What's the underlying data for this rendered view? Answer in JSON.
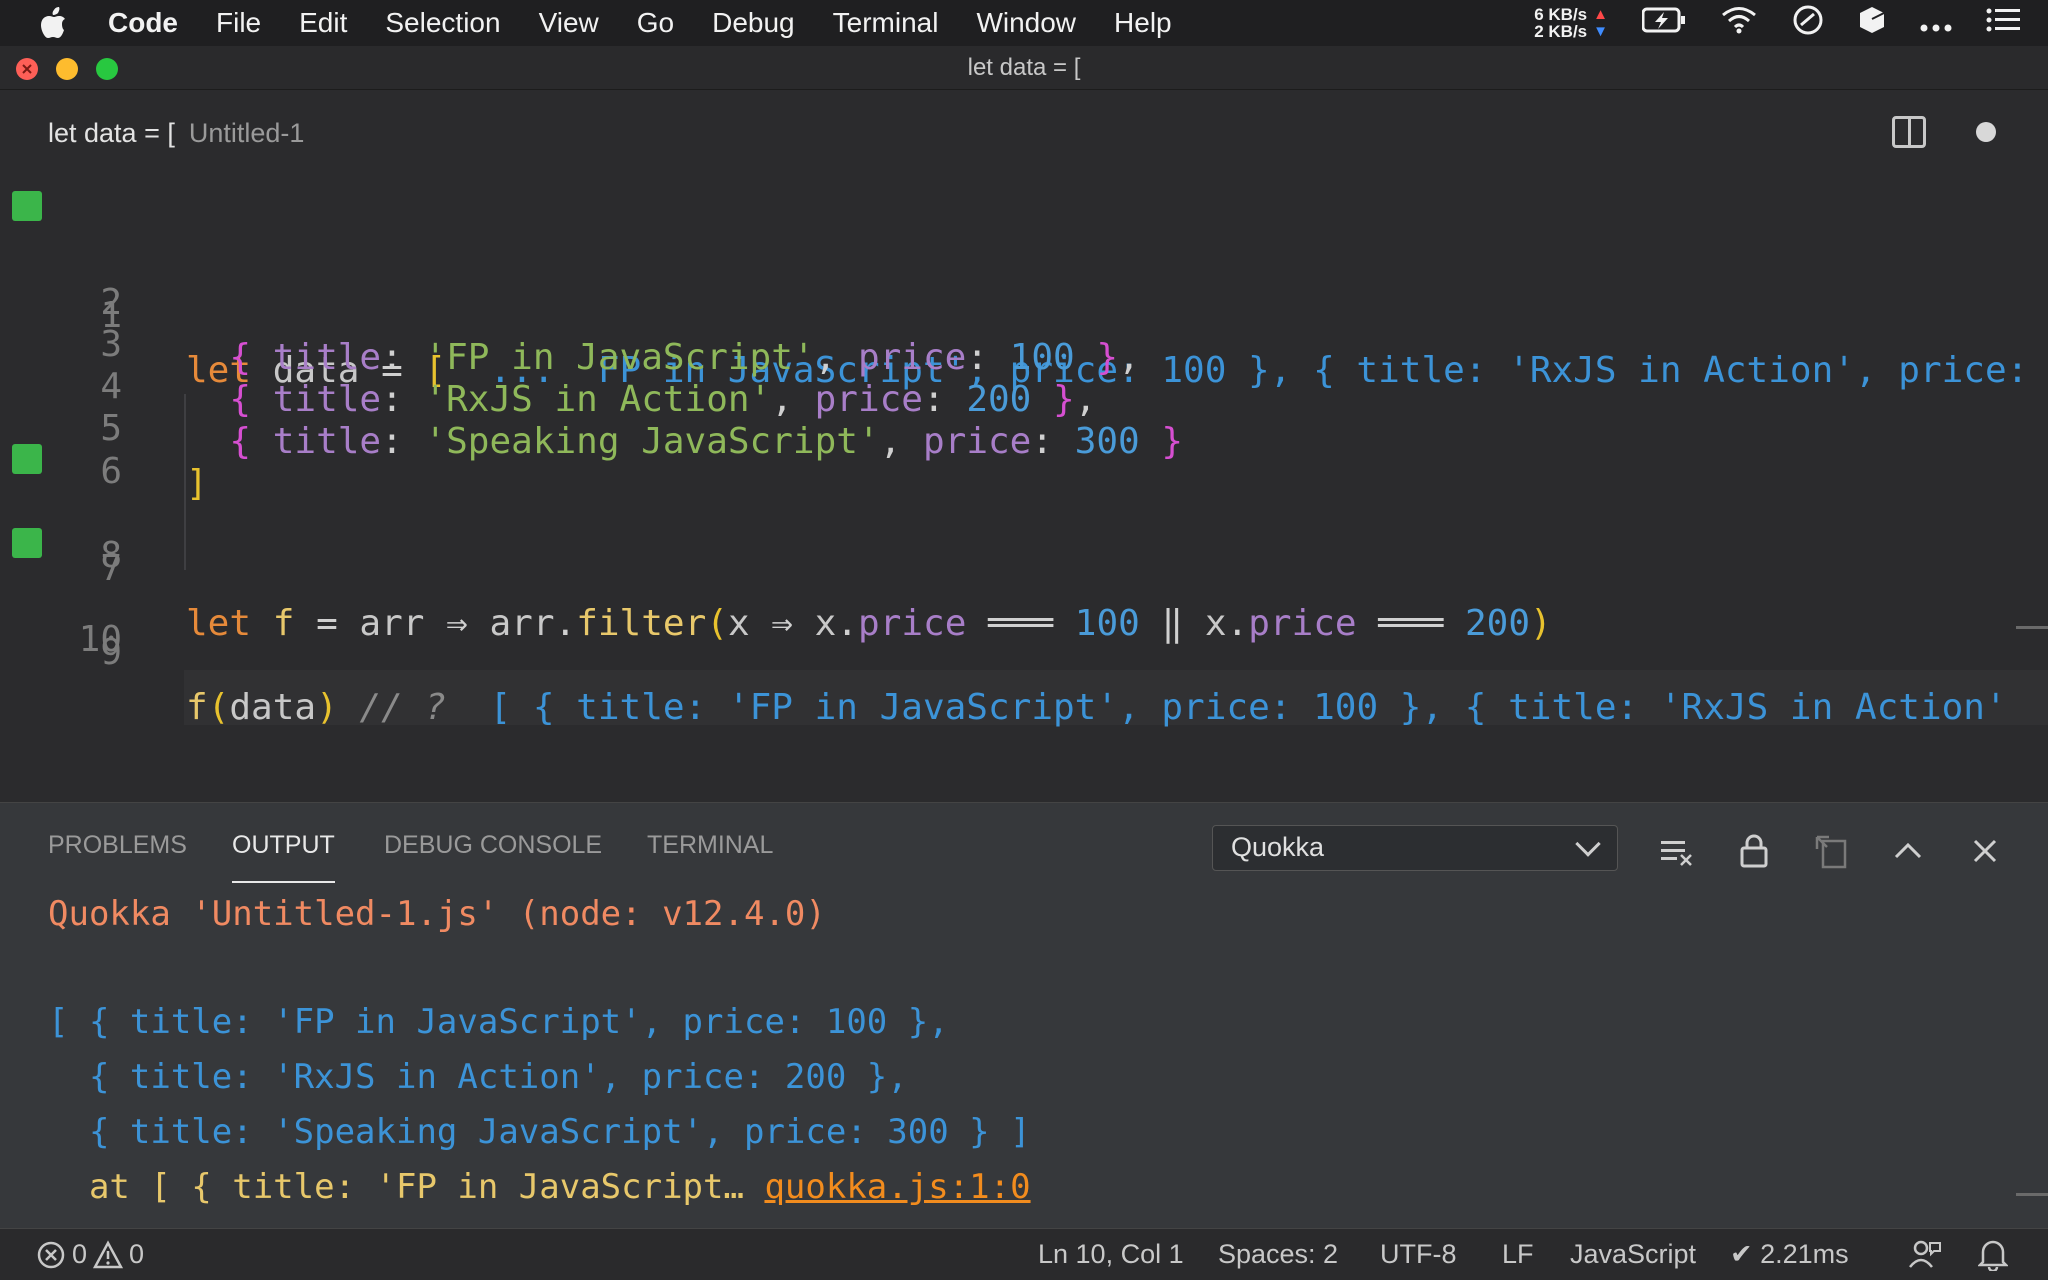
{
  "menubar": {
    "app": "Code",
    "items": [
      "File",
      "Edit",
      "Selection",
      "View",
      "Go",
      "Debug",
      "Terminal",
      "Window",
      "Help"
    ],
    "net_up": "6 KB/s",
    "net_down": "2 KB/s"
  },
  "window": {
    "title": "let data = ["
  },
  "tab": {
    "title": "let data = [",
    "file": "Untitled-1"
  },
  "editor": {
    "current_line": 10,
    "lines": [
      {
        "n": "1",
        "marker": true
      },
      {
        "n": "2",
        "marker": false
      },
      {
        "n": "3",
        "marker": false
      },
      {
        "n": "4",
        "marker": false
      },
      {
        "n": "5",
        "marker": false
      },
      {
        "n": "6",
        "marker": false
      },
      {
        "n": "7",
        "marker": true
      },
      {
        "n": "8",
        "marker": false
      },
      {
        "n": "9",
        "marker": true
      },
      {
        "n": "10",
        "marker": false
      }
    ],
    "line1": {
      "kw": "let",
      "name": " data",
      "eq": " = ",
      "open": "[",
      "inline": "  ...  FP in JavaScript', price: 100 }, { title: 'RxJS in Action', price:"
    },
    "line2": {
      "b1": "{",
      "k1": " title",
      "c1": ": ",
      "s1": "'FP in JavaScript'",
      "c2": ", ",
      "k2": "price",
      "c3": ": ",
      "n1": "100",
      "b2": " }",
      "c4": ","
    },
    "line3": {
      "b1": "{",
      "k1": " title",
      "c1": ": ",
      "s1": "'RxJS in Action'",
      "c2": ", ",
      "k2": "price",
      "c3": ": ",
      "n1": "200",
      "b2": " }",
      "c4": ","
    },
    "line4": {
      "b1": "{",
      "k1": " title",
      "c1": ": ",
      "s1": "'Speaking JavaScript'",
      "c2": ", ",
      "k2": "price",
      "c3": ": ",
      "n1": "300",
      "b2": " }"
    },
    "line5": {
      "close": "]"
    },
    "line7": {
      "kw": "let",
      "f": " f",
      "eq": " = ",
      "arr": "arr",
      "arrow1": " ⇒ ",
      "arr2": "arr",
      "dot1": ".",
      "filter": "filter",
      "p1": "(",
      "x1": "x",
      "arrow2": " ⇒ ",
      "x2": "x",
      "dot2": ".",
      "price1": "price",
      "eq1": " ═══ ",
      "v1": "100",
      "or": " ‖ ",
      "x3": "x",
      "dot3": ".",
      "price2": "price",
      "eq2": " ═══ ",
      "v2": "200",
      "p2": ")"
    },
    "line9": {
      "f": "f",
      "p1": "(",
      "arg": "data",
      "p2": ")",
      "comment": " // ? ",
      "inline": " [ { title: 'FP in JavaScript', price: 100 }, { title: 'RxJS in Action'"
    }
  },
  "panel": {
    "tabs": [
      "PROBLEMS",
      "OUTPUT",
      "DEBUG CONSOLE",
      "TERMINAL"
    ],
    "active_tab": "OUTPUT",
    "channel": "Quokka",
    "output": {
      "header": "Quokka 'Untitled-1.js' (node: v12.4.0)",
      "line1": "[ { title: 'FP in JavaScript', price: 100 },",
      "line2": "  { title: 'RxJS in Action', price: 200 },",
      "line3": "  { title: 'Speaking JavaScript', price: 300 } ]",
      "at_text": "  at [ { title: 'FP in JavaScript… ",
      "link": "quokka.js:1:0"
    }
  },
  "statusbar": {
    "errors": "0",
    "warnings": "0",
    "position": "Ln 10, Col 1",
    "spaces": "Spaces: 2",
    "encoding": "UTF-8",
    "eol": "LF",
    "language": "JavaScript",
    "timing": "✔ 2.21ms"
  },
  "colors": {
    "keyword": "#e68a3a",
    "string": "#8fb85a",
    "number": "#4a9bd8",
    "property": "#a87ec8",
    "gutter_marker": "#3bb54a",
    "quokka_header": "#f08a62",
    "link": "#f28c1e"
  }
}
